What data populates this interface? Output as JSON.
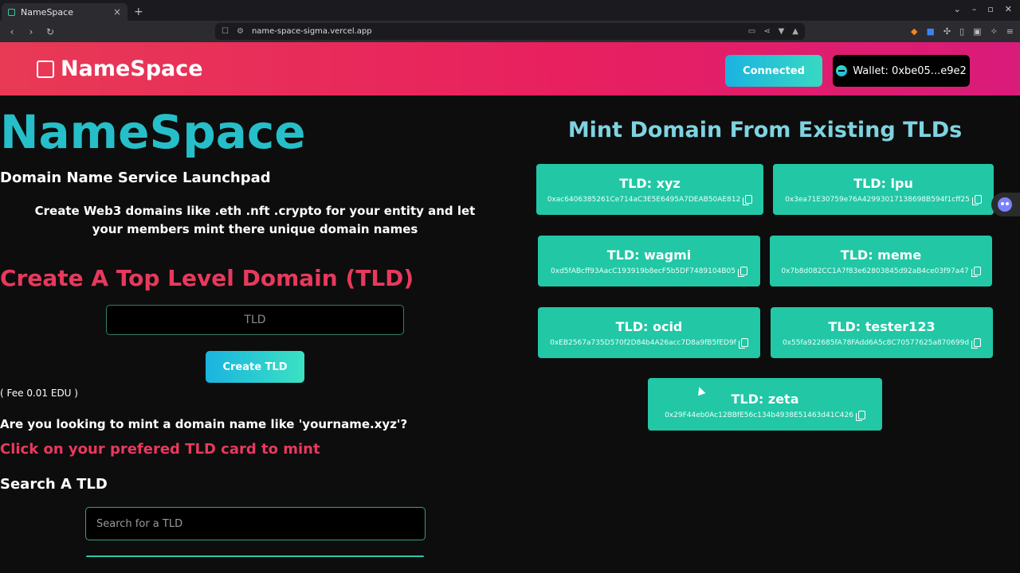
{
  "browser": {
    "tab_title": "NameSpace",
    "tab_close": "×",
    "new_tab": "+",
    "url": "name-space-sigma.vercel.app"
  },
  "header": {
    "logo_text": "NameSpace",
    "connected_label": "Connected",
    "wallet_label": "Wallet: 0xbe05...e9e2"
  },
  "left": {
    "big_title": "NameSpace",
    "subtitle": "Domain Name Service Launchpad",
    "description": "Create Web3 domains like .eth .nft .crypto for your entity and let your members mint there unique domain names",
    "create_title": "Create A Top Level Domain (TLD)",
    "tld_placeholder": "TLD",
    "create_button": "Create TLD",
    "fee": "( Fee 0.01 EDU )",
    "looking_text": "Are you looking to mint a domain name like 'yourname.xyz'?",
    "click_hint": "Click on your prefered TLD card to mint",
    "search_title": "Search A TLD",
    "search_placeholder": "Search for a TLD"
  },
  "right": {
    "mint_title": "Mint Domain From Existing TLDs",
    "cards": [
      {
        "name": "TLD: xyz",
        "address": "0xac6406385261Ce714aC3E5E6495A7DEAB50AE812"
      },
      {
        "name": "TLD: lpu",
        "address": "0x3ea71E30759e76A42993017138698B594f1cff25"
      },
      {
        "name": "TLD: wagmi",
        "address": "0xd5fABcff93AacC193919b8ecF5b5DF7489104B05"
      },
      {
        "name": "TLD: meme",
        "address": "0x7b8d082CC1A7f83e62803845d92aB4ce03f97a47"
      },
      {
        "name": "TLD: ocid",
        "address": "0xEB2567a735D570f2D84b4A26acc7D8a9fB5fED9f"
      },
      {
        "name": "TLD: tester123",
        "address": "0x55fa922685fA78FAdd6A5c8C70577625a870699d"
      },
      {
        "name": "TLD: zeta",
        "address": "0x29F44eb0Ac12BBfE56c134b4938E51463d41C426"
      }
    ]
  }
}
